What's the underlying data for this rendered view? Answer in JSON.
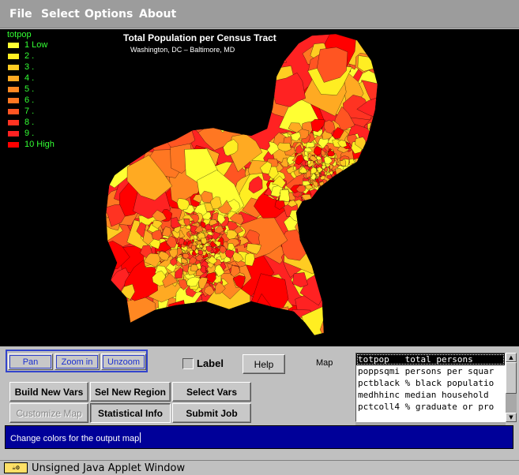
{
  "menu": {
    "items": [
      {
        "label": "File"
      },
      {
        "label": "Select"
      },
      {
        "label": "Options"
      },
      {
        "label": "About"
      }
    ]
  },
  "map": {
    "title": "Total Population per Census Tract",
    "subtitle": "Washington, DC – Baltimore, MD",
    "legend": {
      "title": "totpop",
      "items": [
        {
          "label": "1  Low",
          "color": "#ffff33"
        },
        {
          "label": "2  .",
          "color": "#ffee22"
        },
        {
          "label": "3  .",
          "color": "#ffcc22"
        },
        {
          "label": "4  .",
          "color": "#ffaa22"
        },
        {
          "label": "5  .",
          "color": "#ff8822"
        },
        {
          "label": "6  .",
          "color": "#ff7722"
        },
        {
          "label": "7  .",
          "color": "#ff5522"
        },
        {
          "label": "8  .",
          "color": "#ff3322"
        },
        {
          "label": "9  .",
          "color": "#ff2222"
        },
        {
          "label": "10  High",
          "color": "#ff0000"
        }
      ]
    },
    "colors": [
      "#ffff33",
      "#ffee22",
      "#ffcc22",
      "#ffaa22",
      "#ff8822",
      "#ff7722",
      "#ff5522",
      "#ff3322",
      "#ff2222",
      "#ff0000"
    ]
  },
  "controls": {
    "pan_label": "Pan",
    "zoom_in_label": "Zoom in",
    "unzoom_label": "Unzoom",
    "label_checkbox": "Label",
    "help_label": "Help",
    "map_label": "Map",
    "build_new_vars_label": "Build New Vars",
    "sel_new_region_label": "Sel New Region",
    "select_vars_label": "Select Vars",
    "customize_map_label": "Customize Map",
    "statistical_info_label": "Statistical Info",
    "submit_job_label": "Submit Job"
  },
  "variables": [
    {
      "text": "totpop   total persons"
    },
    {
      "text": "poppsqmi persons per squar"
    },
    {
      "text": "pctblack % black populatio"
    },
    {
      "text": "medhhinc median household"
    },
    {
      "text": "pctcoll4 % graduate or pro"
    }
  ],
  "status": {
    "message": "Change colors for the output map"
  },
  "footer": {
    "text": "Unsigned Java Applet Window",
    "icon": "java-applet-icon"
  }
}
